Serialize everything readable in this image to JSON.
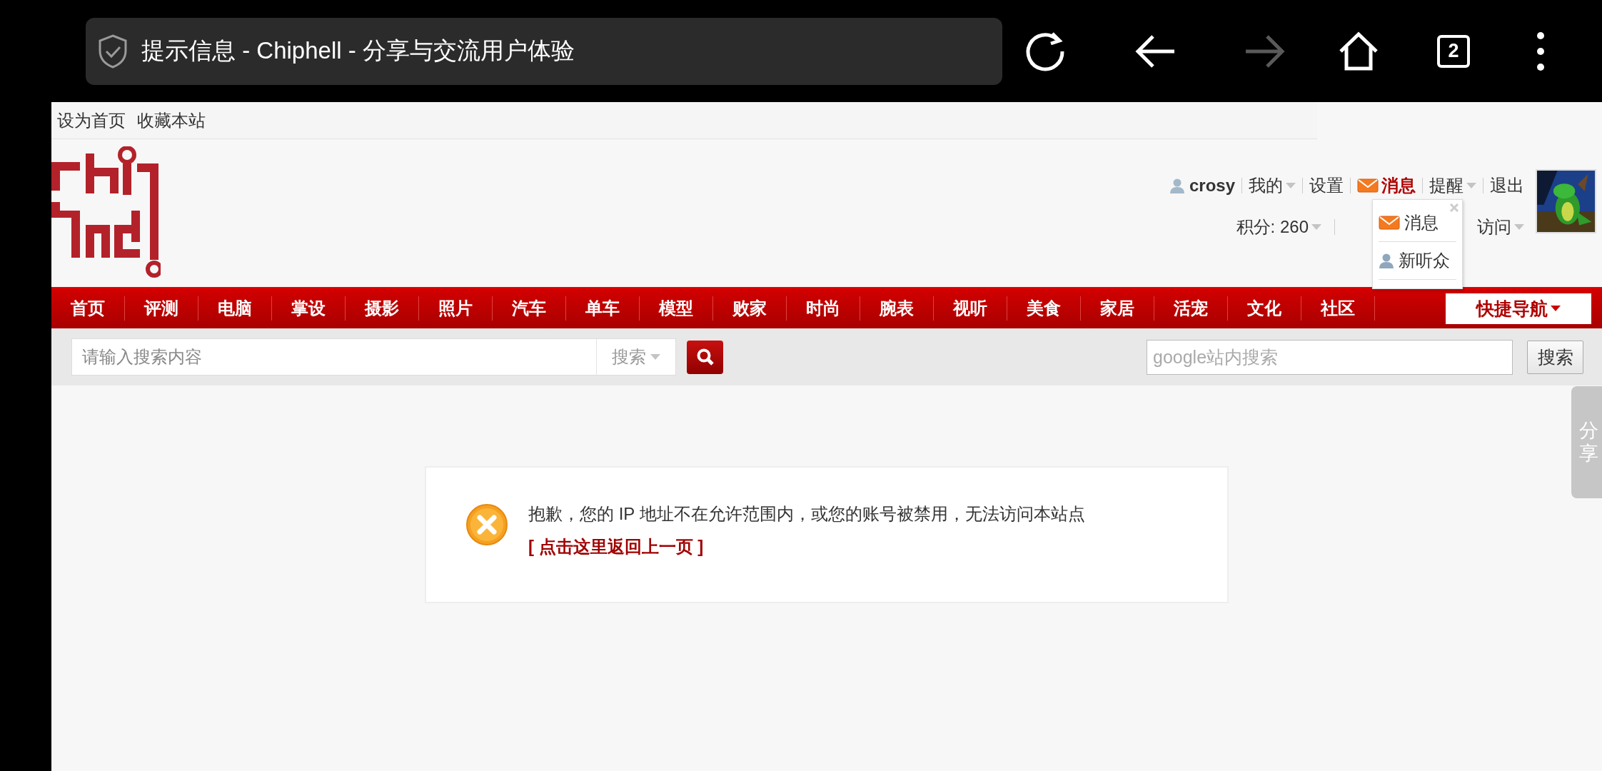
{
  "browser": {
    "title": "提示信息 - Chiphell - 分享与交流用户体验",
    "tab_count": "2",
    "forward_disabled": true
  },
  "top_links": [
    "设为首页",
    "收藏本站"
  ],
  "user_bar": {
    "username": "crosy",
    "items": [
      {
        "label": "我的",
        "kind": "dropdown"
      },
      {
        "label": "设置",
        "kind": "link"
      },
      {
        "label": "消息",
        "kind": "message"
      },
      {
        "label": "提醒",
        "kind": "dropdown"
      },
      {
        "label": "退出",
        "kind": "link"
      }
    ],
    "points": "积分: 260",
    "access": "访问"
  },
  "popup": {
    "items": [
      {
        "label": "消息",
        "kind": "message"
      },
      {
        "label": "新听众",
        "kind": "follower"
      }
    ]
  },
  "nav": {
    "items": [
      "首页",
      "评测",
      "电脑",
      "掌设",
      "摄影",
      "照片",
      "汽车",
      "单车",
      "模型",
      "败家",
      "时尚",
      "腕表",
      "视听",
      "美食",
      "家居",
      "活宠",
      "文化",
      "社区"
    ],
    "quick_nav": "快捷导航"
  },
  "search": {
    "placeholder": "请输入搜索内容",
    "scope": "搜索",
    "google_placeholder": "google站内搜索",
    "google_button": "搜索"
  },
  "share_tab": "分享",
  "message": {
    "text": "抱歉，您的 IP 地址不在允许范围内，或您的账号被禁用，无法访问本站点",
    "link": "[ 点击这里返回上一页 ]"
  }
}
